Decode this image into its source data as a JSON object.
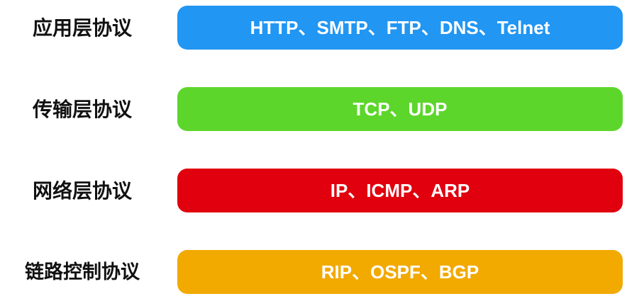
{
  "layers": [
    {
      "label": "应用层协议",
      "protocols": "HTTP、SMTP、FTP、DNS、Telnet",
      "color": "#2196f3"
    },
    {
      "label": "传输层协议",
      "protocols": "TCP、UDP",
      "color": "#5dd62c"
    },
    {
      "label": "网络层协议",
      "protocols": "IP、ICMP、ARP",
      "color": "#e0000e"
    },
    {
      "label": "链路控制协议",
      "protocols": "RIP、OSPF、BGP",
      "color": "#f2a900"
    }
  ]
}
